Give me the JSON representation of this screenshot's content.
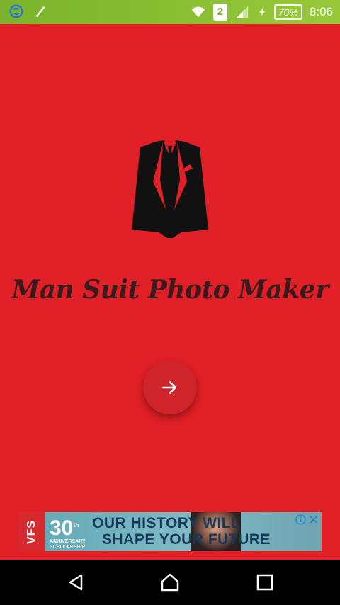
{
  "status_bar": {
    "left_icons": [
      "sync-icon",
      "phone-icon"
    ],
    "right_icons": [
      "wifi-icon",
      "sim-icon",
      "signal-icon",
      "charging-icon"
    ],
    "sim_slot": "2",
    "battery": "70%",
    "time": "8:06",
    "background": "#8fc035"
  },
  "main": {
    "background": "#e01f26",
    "logo_icon": "suit-icon",
    "app_title": "Man Suit Photo Maker",
    "next_icon": "arrow-right-icon"
  },
  "ad": {
    "brand": "VFS",
    "anniversary_number": "30",
    "anniversary_suffix": "th",
    "anniversary_line1": "ANNIVERSARY",
    "anniversary_line2": "SCHOLARSHIP",
    "headline_line1": "OUR HISTORY WILL",
    "headline_line2": "SHAPE YOUR FUTURE"
  },
  "nav_bar": {
    "icons": [
      "back-icon",
      "home-icon",
      "recents-icon"
    ]
  }
}
